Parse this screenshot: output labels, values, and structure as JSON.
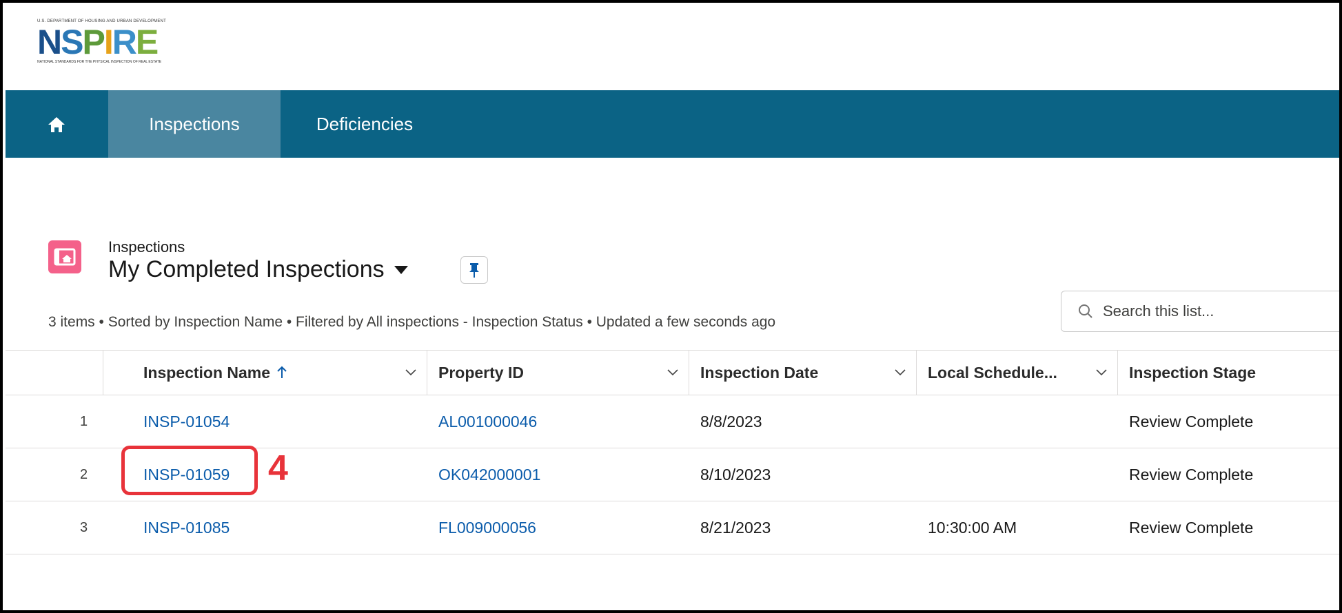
{
  "logo": {
    "top_text": "U.S. DEPARTMENT OF HOUSING AND URBAN DEVELOPMENT",
    "word": "NSPIRE",
    "bottom_text": "NATIONAL STANDARDS FOR THE PHYSICAL INSPECTION OF REAL ESTATE"
  },
  "nav": {
    "home_icon": "home-icon",
    "tabs": [
      {
        "label": "Inspections",
        "active": true
      },
      {
        "label": "Deficiencies",
        "active": false
      }
    ]
  },
  "list_header": {
    "object_label": "Inspections",
    "title": "My Completed Inspections",
    "summary": "3 items • Sorted by Inspection Name • Filtered by All inspections - Inspection Status • Updated a few seconds ago"
  },
  "search": {
    "placeholder": "Search this list..."
  },
  "table": {
    "columns": [
      {
        "label": "Inspection Name",
        "sorted": "asc"
      },
      {
        "label": "Property ID"
      },
      {
        "label": "Inspection Date"
      },
      {
        "label": "Local Schedule..."
      },
      {
        "label": "Inspection Stage"
      }
    ],
    "rows": [
      {
        "num": "1",
        "name": "INSP-01054",
        "property_id": "AL001000046",
        "date": "8/8/2023",
        "local_schedule": "",
        "stage": "Review Complete"
      },
      {
        "num": "2",
        "name": "INSP-01059",
        "property_id": "OK042000001",
        "date": "8/10/2023",
        "local_schedule": "",
        "stage": "Review Complete"
      },
      {
        "num": "3",
        "name": "INSP-01085",
        "property_id": "FL009000056",
        "date": "8/21/2023",
        "local_schedule": "10:30:00 AM",
        "stage": "Review Complete"
      }
    ]
  },
  "annotation": {
    "number": "4",
    "color": "#e8333a"
  },
  "colors": {
    "navbar": "#0b6385",
    "nav_active": "#4a86a0",
    "link": "#0b5cab",
    "list_icon": "#f4618a"
  }
}
